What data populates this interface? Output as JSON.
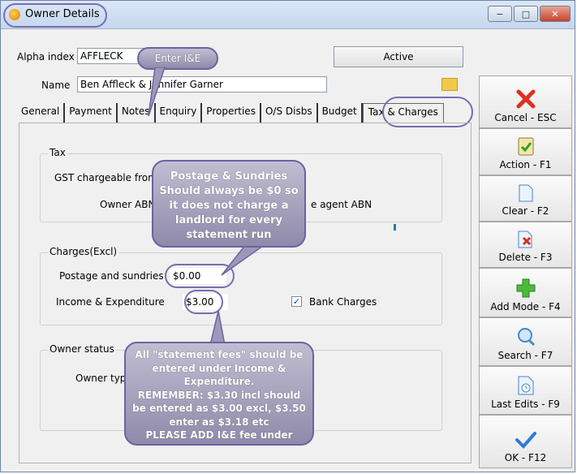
{
  "window": {
    "title": "Owner Details",
    "controls": {
      "minimize": "−",
      "maximize": "□",
      "close": "✕"
    }
  },
  "fields": {
    "alpha_label": "Alpha index",
    "alpha_value": "AFFLECK",
    "status_button": "Active",
    "name_label": "Name",
    "name_value": "Ben Affleck & Jennifer Garner"
  },
  "tabs": [
    "General",
    "Payment",
    "Notes",
    "Enquiry",
    "Properties",
    "O/S Disbs",
    "Budget",
    "Tax & Charges"
  ],
  "tax": {
    "group_label": "Tax",
    "gst_label": "GST chargeable from",
    "owner_abn_label": "Owner ABN",
    "agent_abn_label": "e agent ABN"
  },
  "charges": {
    "group_label": "Charges(Excl)",
    "postage_label": "Postage and sundries",
    "postage_value": "$0.00",
    "ie_label": "Income & Expenditure",
    "ie_value": "$3.00",
    "bank_charges_label": "Bank Charges",
    "bank_charges_checked": "✓"
  },
  "owner_status": {
    "group_label": "Owner status",
    "type_label": "Owner type"
  },
  "side_buttons": [
    {
      "label": "Cancel - ESC",
      "icon": "cancel-x-icon"
    },
    {
      "label": "Action - F1",
      "icon": "action-clipboard-icon"
    },
    {
      "label": "Clear - F2",
      "icon": "clear-document-icon"
    },
    {
      "label": "Delete - F3",
      "icon": "delete-document-icon"
    },
    {
      "label": "Add Mode - F4",
      "icon": "add-plus-icon"
    },
    {
      "label": "Search - F7",
      "icon": "search-magnifier-icon"
    },
    {
      "label": "Last Edits - F9",
      "icon": "last-edits-clock-icon"
    },
    {
      "label": "OK - F12",
      "icon": "ok-checkmark-icon"
    }
  ],
  "annotations": {
    "enter_ie": "Enter I&E",
    "postage_callout": [
      "Postage & Sundries",
      "Should always be $0 so",
      "it does not charge a",
      "landlord for every",
      "statement run"
    ],
    "fees_callout": [
      "All \"statement fees\" should be",
      "entered under Income &",
      "Expenditure.",
      "REMEMBER: $3.30 incl should",
      "be entered as $3.00 excl, $3.50",
      "enter as $3.18 etc",
      "PLEASE ADD I&E fee under"
    ]
  },
  "colors": {
    "annotation_purple": "#7d6bb0",
    "callout_fill": "#9d98b8"
  }
}
